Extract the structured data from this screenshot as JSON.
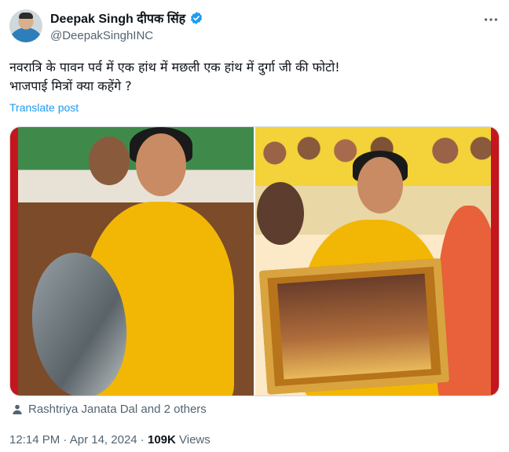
{
  "author": {
    "display_name": "Deepak Singh दीपक सिंह",
    "handle": "@DeepakSinghINC",
    "verified": true
  },
  "post": {
    "text": "नवरात्रि के पावन पर्व में एक हांथ में मछली एक हांथ में दुर्गा जी की फोटो!\nभाजपाई मित्रों क्या कहेंगे ?",
    "translate_label": "Translate post"
  },
  "social_context": {
    "text": "Rashtriya Janata Dal and 2 others"
  },
  "meta": {
    "time": "12:14 PM",
    "separator": " · ",
    "date": "Apr 14, 2024",
    "views_count": "109K",
    "views_label": " Views"
  },
  "colors": {
    "accent": "#1d9bf0",
    "secondary_text": "#536471",
    "primary_text": "#0f1419"
  },
  "icons": {
    "verified": "verified-badge-icon",
    "more": "more-options-icon",
    "person": "person-icon"
  }
}
